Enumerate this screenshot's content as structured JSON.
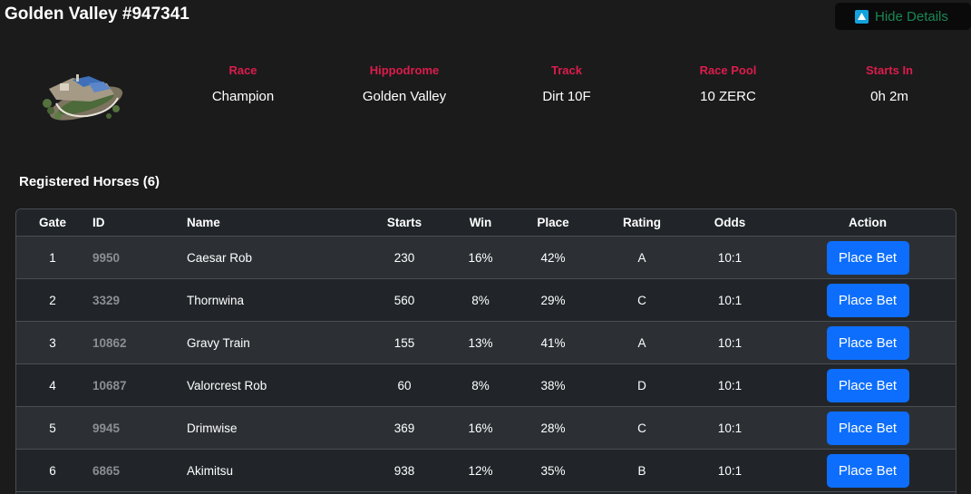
{
  "header": {
    "title": "Golden Valley #947341",
    "hide_details_label": "Hide Details"
  },
  "race_info": {
    "race_label": "Race",
    "race_value": "Champion",
    "hippodrome_label": "Hippodrome",
    "hippodrome_value": "Golden Valley",
    "track_label": "Track",
    "track_value": "Dirt 10F",
    "pool_label": "Race Pool",
    "pool_value": "10 ZERC",
    "starts_label": "Starts In",
    "starts_value": "0h 2m"
  },
  "horses": {
    "section_title": "Registered Horses (6)",
    "columns": [
      "Gate",
      "ID",
      "Name",
      "Starts",
      "Win",
      "Place",
      "Rating",
      "Odds",
      "Action"
    ],
    "bet_label": "Place Bet",
    "rows": [
      {
        "gate": "1",
        "id": "9950",
        "name": "Caesar Rob",
        "starts": "230",
        "win": "16%",
        "place": "42%",
        "rating": "A",
        "odds": "10:1"
      },
      {
        "gate": "2",
        "id": "3329",
        "name": "Thornwina",
        "starts": "560",
        "win": "8%",
        "place": "29%",
        "rating": "C",
        "odds": "10:1"
      },
      {
        "gate": "3",
        "id": "10862",
        "name": "Gravy Train",
        "starts": "155",
        "win": "13%",
        "place": "41%",
        "rating": "A",
        "odds": "10:1"
      },
      {
        "gate": "4",
        "id": "10687",
        "name": "Valorcrest Rob",
        "starts": "60",
        "win": "8%",
        "place": "38%",
        "rating": "D",
        "odds": "10:1"
      },
      {
        "gate": "5",
        "id": "9945",
        "name": "Drimwise",
        "starts": "369",
        "win": "16%",
        "place": "28%",
        "rating": "C",
        "odds": "10:1"
      },
      {
        "gate": "6",
        "id": "6865",
        "name": "Akimitsu",
        "starts": "938",
        "win": "12%",
        "place": "35%",
        "rating": "B",
        "odds": "10:1"
      }
    ]
  },
  "colors": {
    "background": "#1b1b1c",
    "accent_red": "#dc1c4b",
    "button_blue": "#0d6efd",
    "hide_green": "#198754"
  },
  "icons": {
    "hide_details": "caret-up-icon",
    "track": "racetrack-illustration"
  }
}
